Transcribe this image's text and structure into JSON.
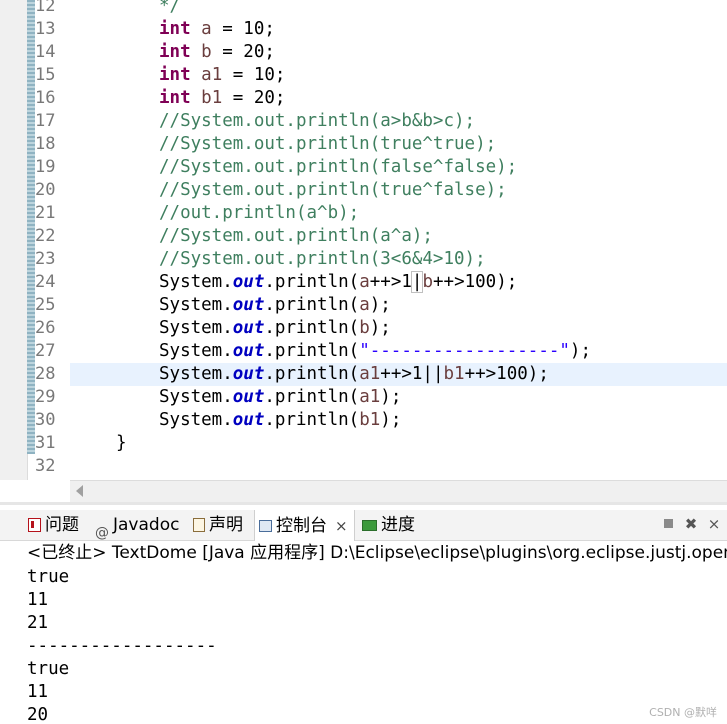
{
  "editor": {
    "lines": [
      {
        "num": "12",
        "tokens": [
          {
            "t": "*/",
            "c": "cm"
          }
        ]
      },
      {
        "num": "13",
        "tokens": [
          {
            "t": "int",
            "c": "kw"
          },
          {
            "t": " "
          },
          {
            "t": "a",
            "c": "var"
          },
          {
            "t": " = 10;"
          }
        ]
      },
      {
        "num": "14",
        "tokens": [
          {
            "t": "int",
            "c": "kw"
          },
          {
            "t": " "
          },
          {
            "t": "b",
            "c": "var"
          },
          {
            "t": " = 20;"
          }
        ]
      },
      {
        "num": "15",
        "tokens": [
          {
            "t": "int",
            "c": "kw"
          },
          {
            "t": " "
          },
          {
            "t": "a1",
            "c": "var"
          },
          {
            "t": " = 10;"
          }
        ]
      },
      {
        "num": "16",
        "tokens": [
          {
            "t": "int",
            "c": "kw"
          },
          {
            "t": " "
          },
          {
            "t": "b1",
            "c": "var"
          },
          {
            "t": " = 20;"
          }
        ]
      },
      {
        "num": "17",
        "tokens": [
          {
            "t": "//System.out.println(a>b&b>c);",
            "c": "cm"
          }
        ]
      },
      {
        "num": "18",
        "tokens": [
          {
            "t": "//System.out.println(true^true);",
            "c": "cm"
          }
        ]
      },
      {
        "num": "19",
        "tokens": [
          {
            "t": "//System.out.println(false^false);",
            "c": "cm"
          }
        ]
      },
      {
        "num": "20",
        "tokens": [
          {
            "t": "//System.out.println(true^false);",
            "c": "cm"
          }
        ]
      },
      {
        "num": "21",
        "tokens": [
          {
            "t": "//out.println(a^b);",
            "c": "cm"
          }
        ]
      },
      {
        "num": "22",
        "tokens": [
          {
            "t": "//System.out.println(a^a);",
            "c": "cm"
          }
        ]
      },
      {
        "num": "23",
        "tokens": [
          {
            "t": "//System.out.println(3<6&4>10);",
            "c": "cm"
          }
        ]
      },
      {
        "num": "24",
        "tokens": [
          {
            "t": "System."
          },
          {
            "t": "out",
            "c": "fld"
          },
          {
            "t": ".println("
          },
          {
            "t": "a",
            "c": "var"
          },
          {
            "t": "++>1"
          },
          {
            "t": "|",
            "c": "box"
          },
          {
            "t": "b",
            "c": "var"
          },
          {
            "t": "++>100);"
          }
        ]
      },
      {
        "num": "25",
        "tokens": [
          {
            "t": "System."
          },
          {
            "t": "out",
            "c": "fld"
          },
          {
            "t": ".println("
          },
          {
            "t": "a",
            "c": "var"
          },
          {
            "t": ");"
          }
        ]
      },
      {
        "num": "26",
        "tokens": [
          {
            "t": "System."
          },
          {
            "t": "out",
            "c": "fld"
          },
          {
            "t": ".println("
          },
          {
            "t": "b",
            "c": "var"
          },
          {
            "t": ");"
          }
        ]
      },
      {
        "num": "27",
        "tokens": [
          {
            "t": "System."
          },
          {
            "t": "out",
            "c": "fld"
          },
          {
            "t": ".println("
          },
          {
            "t": "\"------------------\"",
            "c": "str"
          },
          {
            "t": ");"
          }
        ]
      },
      {
        "num": "28",
        "current": true,
        "tokens": [
          {
            "t": "System."
          },
          {
            "t": "out",
            "c": "fld"
          },
          {
            "t": ".println("
          },
          {
            "t": "a1",
            "c": "var"
          },
          {
            "t": "++>1||"
          },
          {
            "t": "b1",
            "c": "var"
          },
          {
            "t": "++>100);"
          }
        ]
      },
      {
        "num": "29",
        "tokens": [
          {
            "t": "System."
          },
          {
            "t": "out",
            "c": "fld"
          },
          {
            "t": ".println("
          },
          {
            "t": "a1",
            "c": "var"
          },
          {
            "t": ");"
          }
        ]
      },
      {
        "num": "30",
        "tokens": [
          {
            "t": "System."
          },
          {
            "t": "out",
            "c": "fld"
          },
          {
            "t": ".println("
          },
          {
            "t": "b1",
            "c": "var"
          },
          {
            "t": ");"
          }
        ]
      },
      {
        "num": "31",
        "indent": "outer",
        "tokens": [
          {
            "t": "}"
          }
        ]
      },
      {
        "num": "32",
        "tokens": []
      }
    ]
  },
  "views": {
    "tabs": [
      {
        "label": "问题",
        "icon": "problems-icon"
      },
      {
        "label": "Javadoc",
        "icon": "javadoc-icon",
        "glyph": "@"
      },
      {
        "label": "声明",
        "icon": "declaration-icon"
      },
      {
        "label": "控制台",
        "icon": "console-icon",
        "active": true,
        "close": "×"
      },
      {
        "label": "进度",
        "icon": "progress-icon"
      }
    ],
    "toolbar": {
      "remove_all_icon": "✖",
      "remove_launch_icon": "⨯"
    }
  },
  "console": {
    "header": "<已终止> TextDome [Java 应用程序] D:\\Eclipse\\eclipse\\plugins\\org.eclipse.justj.openjdk",
    "output": [
      "true",
      "11",
      "21",
      "------------------",
      "true",
      "11",
      "20"
    ]
  },
  "watermark": "CSDN @默咩",
  "colors": {
    "keyword": "#7f0055",
    "comment": "#3f7f5f",
    "field": "#0000c0",
    "string": "#2a00ff",
    "current_line": "#e8f2fe"
  }
}
